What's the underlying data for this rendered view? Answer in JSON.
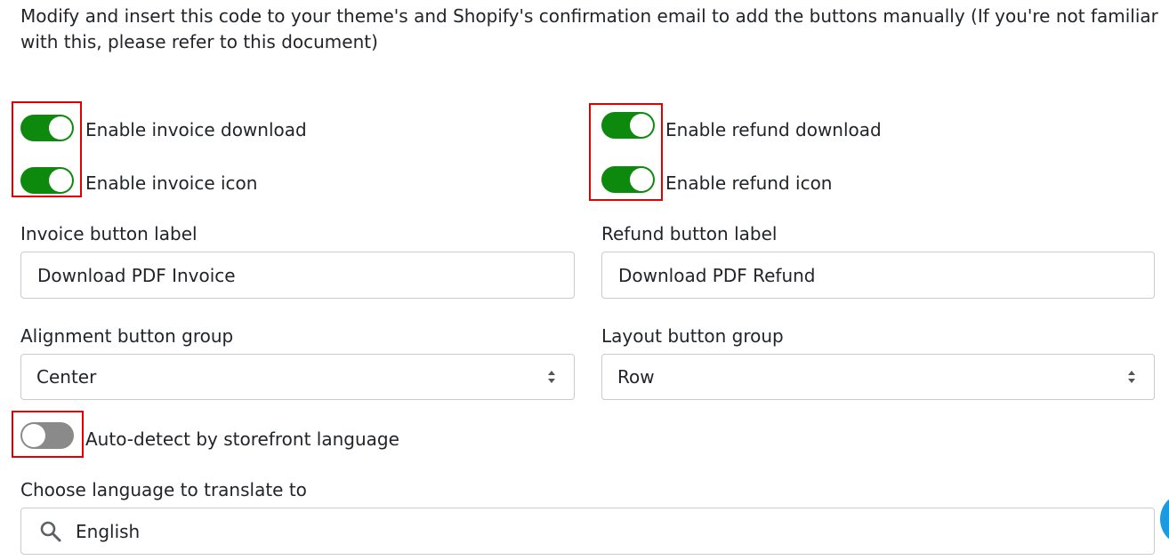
{
  "intro_text": "Modify and insert this code to your theme's and Shopify's confirmation email to add the buttons manually (If you're not familiar with this, please refer to this document)",
  "invoice": {
    "download_toggle": {
      "label": "Enable invoice download",
      "checked": true
    },
    "icon_toggle": {
      "label": "Enable invoice icon",
      "checked": true
    },
    "button_label": {
      "label": "Invoice button label",
      "value": "Download PDF Invoice"
    }
  },
  "refund": {
    "download_toggle": {
      "label": "Enable refund download",
      "checked": true
    },
    "icon_toggle": {
      "label": "Enable refund icon",
      "checked": true
    },
    "button_label": {
      "label": "Refund button label",
      "value": "Download PDF Refund"
    }
  },
  "alignment": {
    "label": "Alignment button group",
    "value": "Center"
  },
  "layout": {
    "label": "Layout button group",
    "value": "Row"
  },
  "auto_detect": {
    "label": "Auto-detect by storefront language",
    "checked": false
  },
  "language": {
    "label": "Choose language to translate to",
    "value": "English"
  },
  "colors": {
    "toggle_on": "#0d8a0d",
    "toggle_off": "#8a8a8a",
    "highlight_box": "#e00000",
    "chat_badge": "#1a9ae0"
  }
}
